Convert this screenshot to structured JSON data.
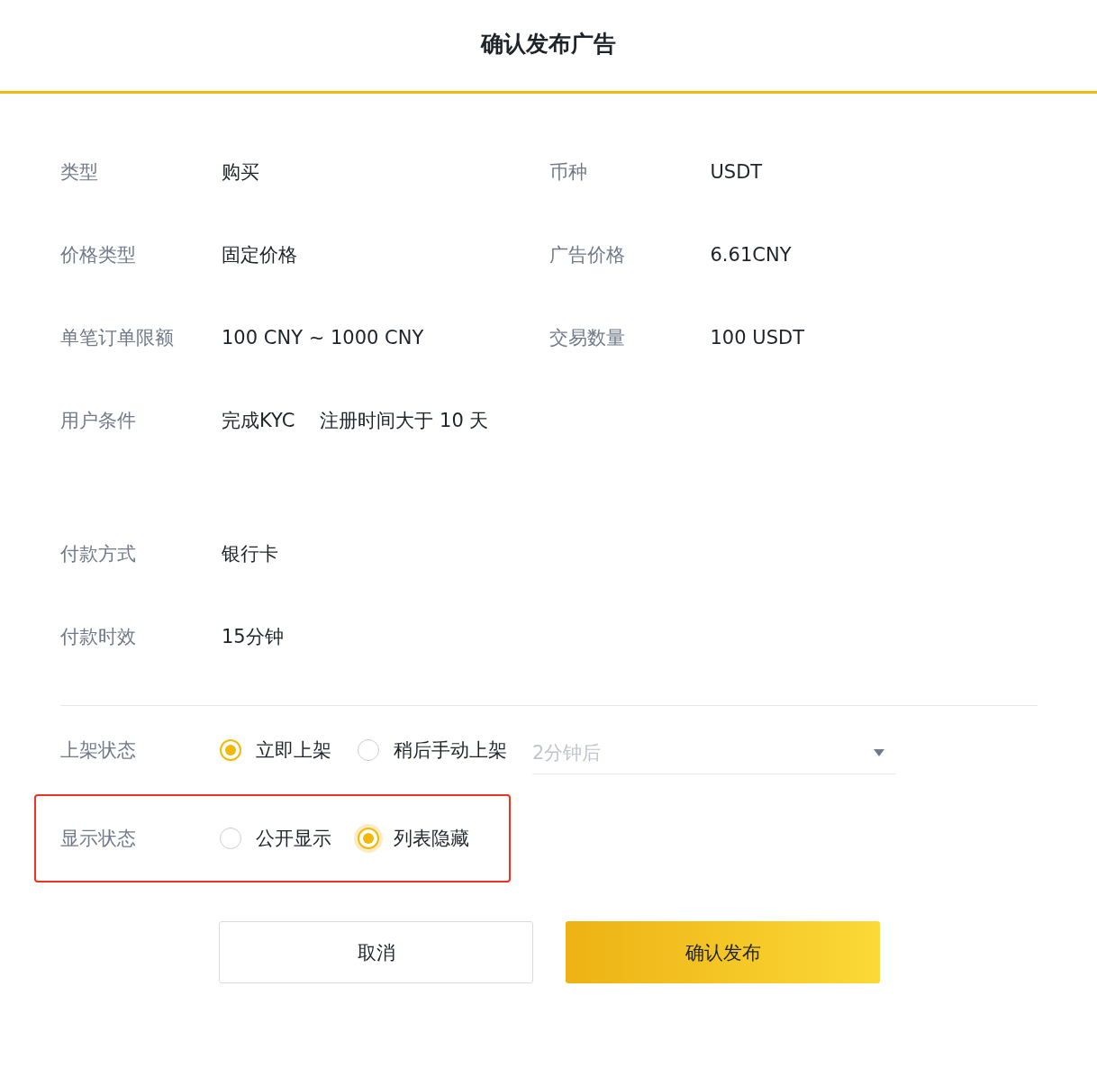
{
  "title": "确认发布广告",
  "details": [
    {
      "cells": [
        {
          "label": "类型",
          "values": [
            "购买"
          ]
        },
        {
          "label": "币种",
          "values": [
            "USDT"
          ]
        }
      ]
    },
    {
      "cells": [
        {
          "label": "价格类型",
          "values": [
            "固定价格"
          ]
        },
        {
          "label": "广告价格",
          "values": [
            "6.61CNY"
          ]
        }
      ]
    },
    {
      "cells": [
        {
          "label": "单笔订单限额",
          "values": [
            "100 CNY ~ 1000 CNY"
          ]
        },
        {
          "label": "交易数量",
          "values": [
            "100 USDT"
          ]
        }
      ]
    },
    {
      "cells": [
        {
          "label": "用户条件",
          "values": [
            "完成KYC",
            "注册时间大于 10 天"
          ]
        }
      ]
    }
  ],
  "payment": [
    {
      "label": "付款方式",
      "value": "银行卡"
    },
    {
      "label": "付款时效",
      "value": "15分钟"
    }
  ],
  "listing_status": {
    "label": "上架状态",
    "highlighted": false,
    "options": [
      {
        "label": "立即上架",
        "selected": true,
        "focused": false
      },
      {
        "label": "稍后手动上架",
        "selected": false,
        "focused": false
      }
    ],
    "select": {
      "placeholder": "2分钟后",
      "disabled": true
    }
  },
  "display_status": {
    "label": "显示状态",
    "highlighted": true,
    "options": [
      {
        "label": "公开显示",
        "selected": false,
        "focused": false
      },
      {
        "label": "列表隐藏",
        "selected": true,
        "focused": true
      }
    ]
  },
  "buttons": [
    {
      "label": "取消",
      "kind": "secondary"
    },
    {
      "label": "确认发布",
      "kind": "primary"
    }
  ]
}
